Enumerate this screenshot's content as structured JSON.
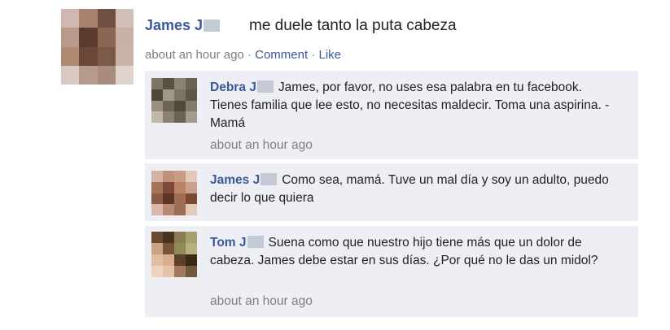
{
  "post": {
    "author_name": "James J",
    "text": "me duele tanto la puta cabeza",
    "time": "about an hour ago",
    "separator": "·",
    "comment_link": "Comment",
    "like_link": "Like"
  },
  "comments": [
    {
      "author_name": "Debra J",
      "text": "James, por favor, no uses esa palabra en tu facebook. Tienes familia que lee esto, no necesitas maldecir. Toma una aspirina. -Mamá",
      "time": "about an hour ago"
    },
    {
      "author_name": "James J",
      "text": "Como sea, mamá. Tuve un mal día y soy un adulto, puedo decir lo que quiera"
    },
    {
      "author_name": "Tom J",
      "text": "Suena como que nuestro hijo tiene más que un dolor de cabeza. James debe estar en sus días. ¿Por qué no le das un midol?",
      "time": "about an hour ago"
    }
  ],
  "colors": {
    "link": "#3b5998",
    "meta": "#808080",
    "comment_bg": "#edeff4",
    "redaction": "#c4c9d6"
  }
}
